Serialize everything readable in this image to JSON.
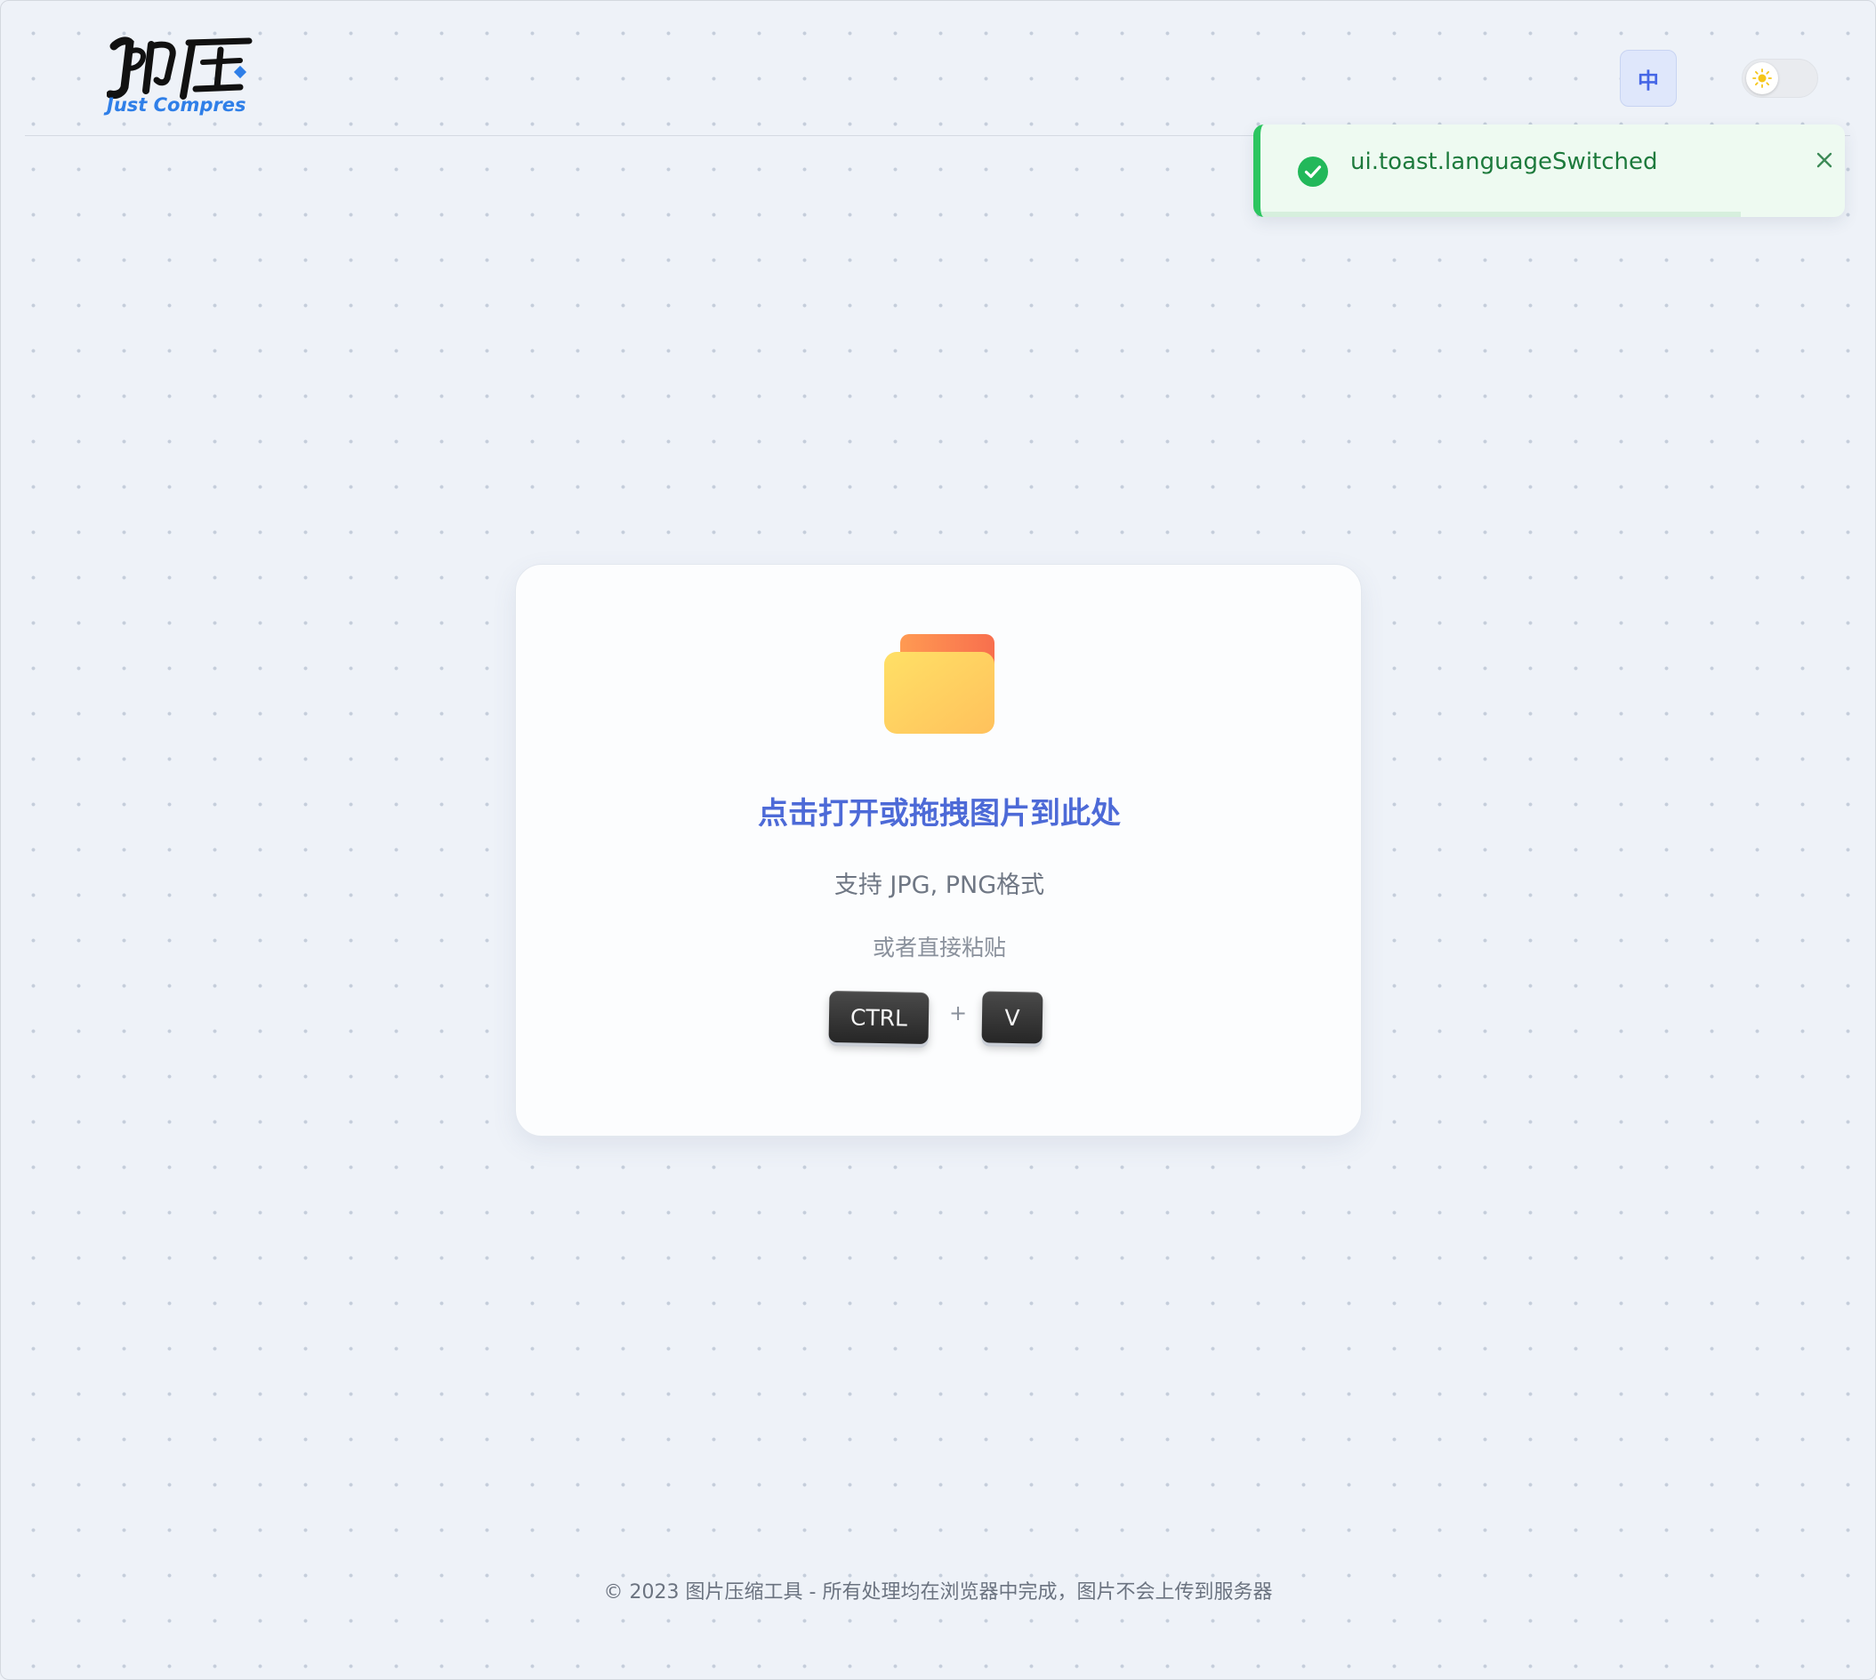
{
  "brand": {
    "logo_text": "即压",
    "logo_subtitle": "Just Compres"
  },
  "header": {
    "language_button_label": "中",
    "theme_toggle_icon": "sun-icon"
  },
  "toast": {
    "message": "ui.toast.languageSwitched",
    "status": "success",
    "accent_color": "#2cc560",
    "icon": "check-circle-icon",
    "close_icon": "close-icon"
  },
  "upload": {
    "icon": "folder-icon",
    "title": "点击打开或拖拽图片到此处",
    "formats": "支持 JPG, PNG格式",
    "paste_hint": "或者直接粘贴",
    "shortcut_keys": [
      "CTRL",
      "V"
    ],
    "shortcut_joiner": "+"
  },
  "footer": {
    "text": "© 2023 图片压缩工具 - 所有处理均在浏览器中完成，图片不会上传到服务器"
  },
  "colors": {
    "accent": "#4d6ad7",
    "toast_success": "#2cc560",
    "brand_blue": "#2f7fe8"
  }
}
